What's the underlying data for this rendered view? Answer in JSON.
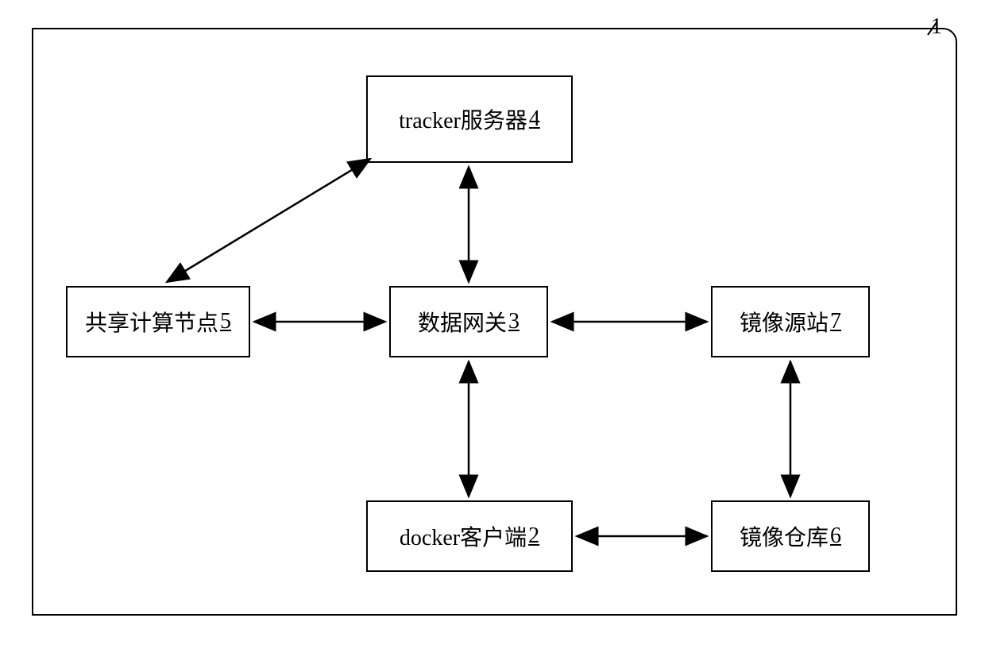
{
  "outer_label": "1",
  "boxes": {
    "tracker": {
      "label": "tracker服务器",
      "num": "4"
    },
    "shared_node": {
      "label": "共享计算节点",
      "num": "5"
    },
    "gateway": {
      "label": "数据网关",
      "num": "3"
    },
    "mirror_origin": {
      "label": "镜像源站",
      "num": "7"
    },
    "docker_client": {
      "label": "docker客户端",
      "num": "2"
    },
    "mirror_repo": {
      "label": "镜像仓库",
      "num": "6"
    }
  }
}
